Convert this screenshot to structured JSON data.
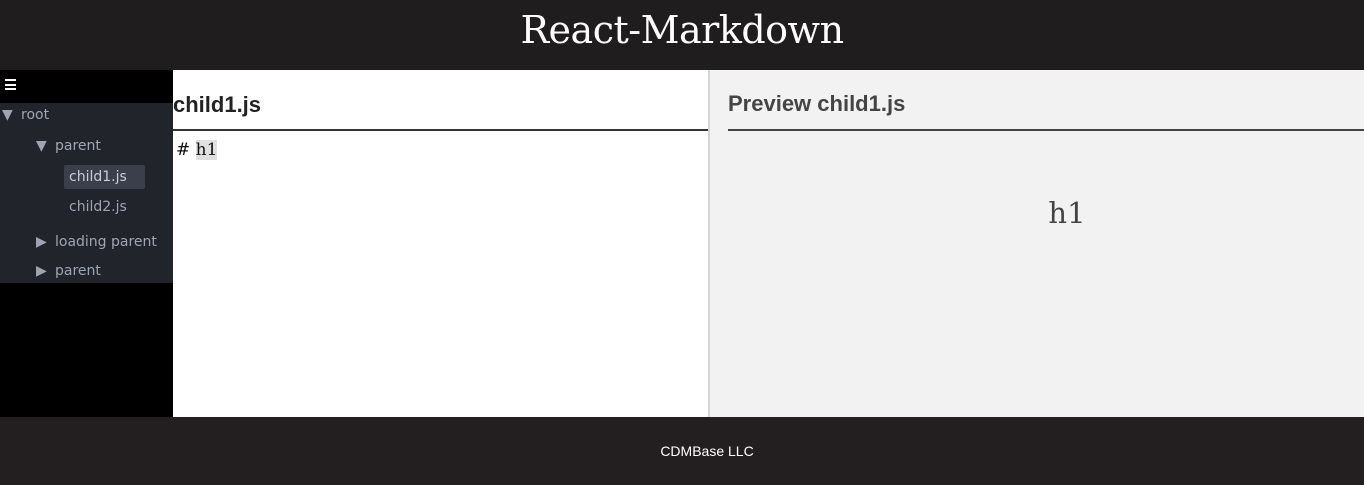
{
  "header": {
    "title": "React-Markdown"
  },
  "sidebar": {
    "menu_icon": "hamburger-icon",
    "tree": [
      {
        "label": "root",
        "expanded": true,
        "icon": "triangle-down-icon",
        "glyph": "▼"
      },
      {
        "label": "parent",
        "expanded": true,
        "icon": "triangle-down-icon",
        "glyph": "▼"
      },
      {
        "label": "child1.js",
        "selected": true
      },
      {
        "label": "child2.js"
      },
      {
        "label": "loading parent",
        "expanded": false,
        "icon": "triangle-right-icon",
        "glyph": "▶"
      },
      {
        "label": "parent",
        "expanded": false,
        "icon": "triangle-right-icon",
        "glyph": "▶"
      }
    ]
  },
  "editor": {
    "file_name": "child1.js",
    "content_prefix": "# ",
    "content_selected": "h1"
  },
  "preview": {
    "title": "Preview child1.js",
    "rendered_h1": "h1"
  },
  "footer": {
    "text": "CDMBase LLC"
  },
  "colors": {
    "header_bg": "#1f1d1d",
    "sidebar_bg": "#000000",
    "tree_bg": "#21252b",
    "selected_bg": "#3a3f4b",
    "preview_bg": "#f2f2f2",
    "footer_bg": "#231f20"
  }
}
